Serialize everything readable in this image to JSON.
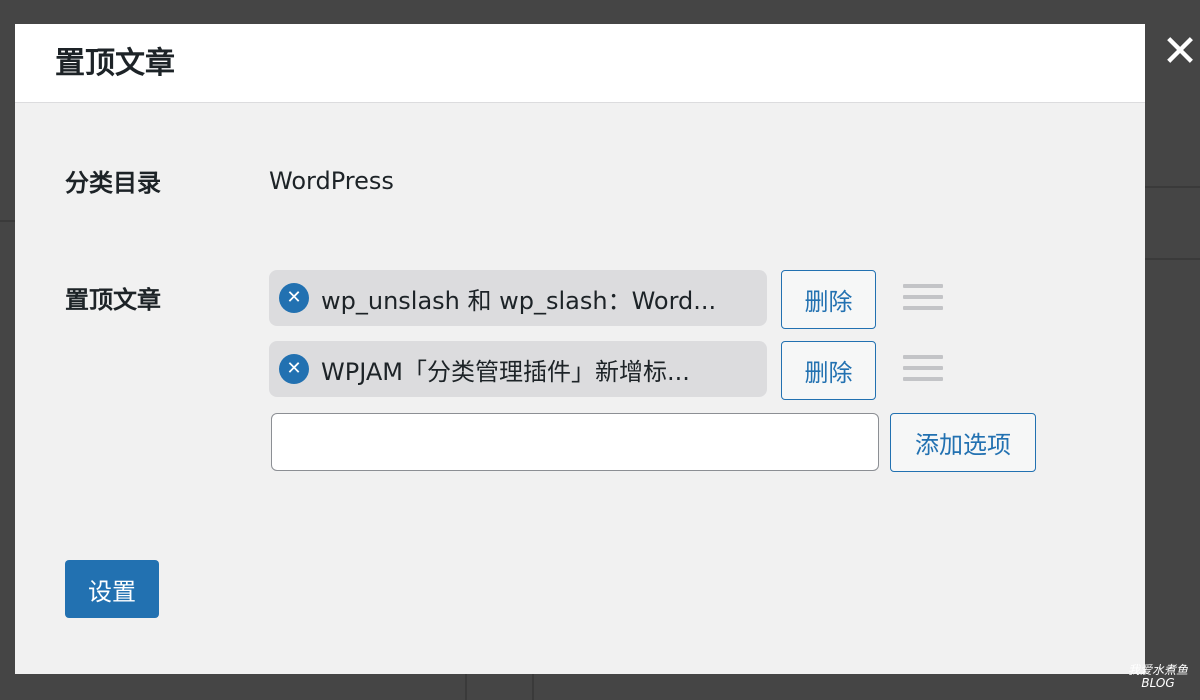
{
  "dialog": {
    "title": "置顶文章",
    "close_glyph": "✕"
  },
  "fields": {
    "category": {
      "label": "分类目录",
      "value": "WordPress"
    },
    "sticky_posts": {
      "label": "置顶文章",
      "items": [
        {
          "title": "wp_unslash 和 wp_slash：Word...",
          "remove_label": "删除"
        },
        {
          "title": "WPJAM「分类管理插件」新增标...",
          "remove_label": "删除"
        }
      ],
      "new_item_value": "",
      "add_option_label": "添加选项"
    }
  },
  "footer": {
    "submit_label": "设置"
  },
  "icons": {
    "remove": "close-circle-icon",
    "drag": "drag-handle-icon",
    "close": "close-icon"
  },
  "colors": {
    "accent": "#2271b1",
    "overlay": "#454545",
    "modal_bg": "#f1f1f1",
    "pill_bg": "#dcdcde"
  },
  "watermark": {
    "line1": "我爱水煮鱼",
    "line2": "BLOG"
  }
}
